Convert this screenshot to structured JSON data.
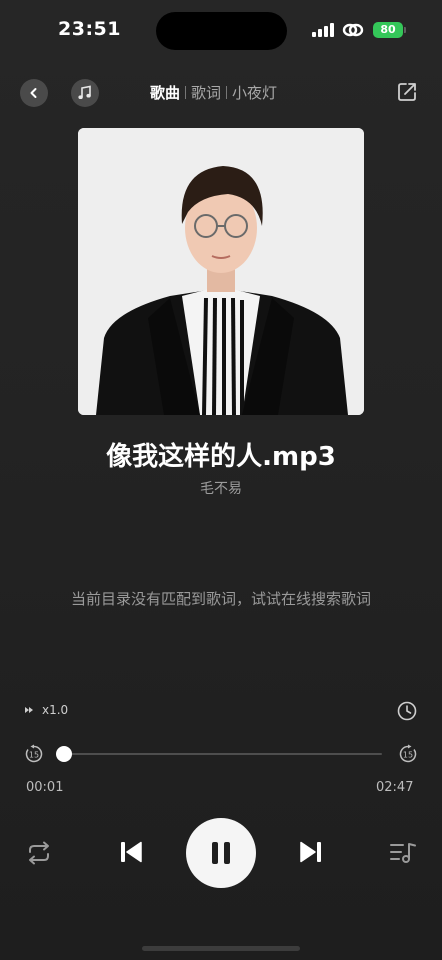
{
  "status_bar": {
    "time": "23:51",
    "battery": "80"
  },
  "header": {
    "tabs": [
      {
        "label": "歌曲",
        "active": true
      },
      {
        "label": "歌词",
        "active": false
      },
      {
        "label": "小夜灯",
        "active": false
      }
    ],
    "icons": {
      "back": "chevron-left-icon",
      "note": "music-note-icon",
      "share": "share-icon"
    }
  },
  "song": {
    "title": "像我这样的人.mp3",
    "artist": "毛不易"
  },
  "lyrics": {
    "message": "当前目录没有匹配到歌词，试试在线搜索歌词"
  },
  "player": {
    "speed": "x1.0",
    "skip_back_label": "15",
    "skip_forward_label": "15",
    "current_time": "00:01",
    "total_time": "02:47",
    "progress": 0.006,
    "state": "playing"
  },
  "colors": {
    "background": "#232323",
    "accent": "#f5f5f5",
    "battery": "#34c759",
    "muted_text": "#9a9a9a"
  }
}
